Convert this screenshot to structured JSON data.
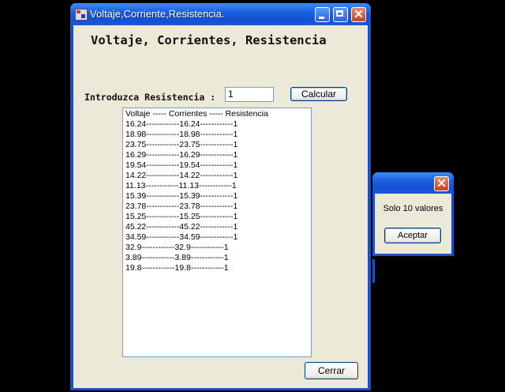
{
  "window": {
    "title": "Voltaje,Corriente,Resistencia.",
    "heading": "Voltaje, Corrientes, Resistencia",
    "resistance_label": "Introduzca Resistencia :",
    "resistance_value": "1",
    "calc_label": "Calcular",
    "close_label": "Cerrar",
    "list_rows": [
      "Voltaje ----- Corrientes ----- Resistencia",
      "16.24------------16.24------------1",
      "18.98------------18.98------------1",
      "23.75------------23.75------------1",
      "16.29------------16.29------------1",
      "19.54------------19.54------------1",
      "14.22------------14.22------------1",
      "11.13------------11.13------------1",
      "15.39------------15.39------------1",
      "23.78------------23.78------------1",
      "15.25------------15.25------------1",
      "45.22------------45.22------------1",
      "34.59------------34.59------------1",
      "32.9------------32.9------------1",
      "3.89------------3.89------------1",
      "19.8------------19.8------------1"
    ]
  },
  "message_box": {
    "text": "Solo 10 valores",
    "ok_label": "Aceptar"
  },
  "colors": {
    "titlebar": "#1c5fe0",
    "client": "#ece9d8",
    "desktop": "#000000"
  }
}
